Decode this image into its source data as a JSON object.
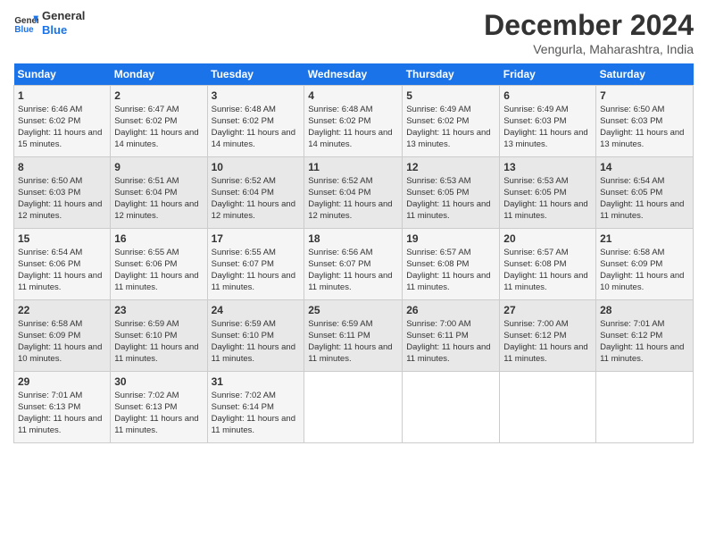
{
  "header": {
    "logo_line1": "General",
    "logo_line2": "Blue",
    "month": "December 2024",
    "location": "Vengurla, Maharashtra, India"
  },
  "days_of_week": [
    "Sunday",
    "Monday",
    "Tuesday",
    "Wednesday",
    "Thursday",
    "Friday",
    "Saturday"
  ],
  "weeks": [
    [
      {
        "day": "1",
        "info": "Sunrise: 6:46 AM\nSunset: 6:02 PM\nDaylight: 11 hours and 15 minutes."
      },
      {
        "day": "2",
        "info": "Sunrise: 6:47 AM\nSunset: 6:02 PM\nDaylight: 11 hours and 14 minutes."
      },
      {
        "day": "3",
        "info": "Sunrise: 6:48 AM\nSunset: 6:02 PM\nDaylight: 11 hours and 14 minutes."
      },
      {
        "day": "4",
        "info": "Sunrise: 6:48 AM\nSunset: 6:02 PM\nDaylight: 11 hours and 14 minutes."
      },
      {
        "day": "5",
        "info": "Sunrise: 6:49 AM\nSunset: 6:02 PM\nDaylight: 11 hours and 13 minutes."
      },
      {
        "day": "6",
        "info": "Sunrise: 6:49 AM\nSunset: 6:03 PM\nDaylight: 11 hours and 13 minutes."
      },
      {
        "day": "7",
        "info": "Sunrise: 6:50 AM\nSunset: 6:03 PM\nDaylight: 11 hours and 13 minutes."
      }
    ],
    [
      {
        "day": "8",
        "info": "Sunrise: 6:50 AM\nSunset: 6:03 PM\nDaylight: 11 hours and 12 minutes."
      },
      {
        "day": "9",
        "info": "Sunrise: 6:51 AM\nSunset: 6:04 PM\nDaylight: 11 hours and 12 minutes."
      },
      {
        "day": "10",
        "info": "Sunrise: 6:52 AM\nSunset: 6:04 PM\nDaylight: 11 hours and 12 minutes."
      },
      {
        "day": "11",
        "info": "Sunrise: 6:52 AM\nSunset: 6:04 PM\nDaylight: 11 hours and 12 minutes."
      },
      {
        "day": "12",
        "info": "Sunrise: 6:53 AM\nSunset: 6:05 PM\nDaylight: 11 hours and 11 minutes."
      },
      {
        "day": "13",
        "info": "Sunrise: 6:53 AM\nSunset: 6:05 PM\nDaylight: 11 hours and 11 minutes."
      },
      {
        "day": "14",
        "info": "Sunrise: 6:54 AM\nSunset: 6:05 PM\nDaylight: 11 hours and 11 minutes."
      }
    ],
    [
      {
        "day": "15",
        "info": "Sunrise: 6:54 AM\nSunset: 6:06 PM\nDaylight: 11 hours and 11 minutes."
      },
      {
        "day": "16",
        "info": "Sunrise: 6:55 AM\nSunset: 6:06 PM\nDaylight: 11 hours and 11 minutes."
      },
      {
        "day": "17",
        "info": "Sunrise: 6:55 AM\nSunset: 6:07 PM\nDaylight: 11 hours and 11 minutes."
      },
      {
        "day": "18",
        "info": "Sunrise: 6:56 AM\nSunset: 6:07 PM\nDaylight: 11 hours and 11 minutes."
      },
      {
        "day": "19",
        "info": "Sunrise: 6:57 AM\nSunset: 6:08 PM\nDaylight: 11 hours and 11 minutes."
      },
      {
        "day": "20",
        "info": "Sunrise: 6:57 AM\nSunset: 6:08 PM\nDaylight: 11 hours and 11 minutes."
      },
      {
        "day": "21",
        "info": "Sunrise: 6:58 AM\nSunset: 6:09 PM\nDaylight: 11 hours and 10 minutes."
      }
    ],
    [
      {
        "day": "22",
        "info": "Sunrise: 6:58 AM\nSunset: 6:09 PM\nDaylight: 11 hours and 10 minutes."
      },
      {
        "day": "23",
        "info": "Sunrise: 6:59 AM\nSunset: 6:10 PM\nDaylight: 11 hours and 11 minutes."
      },
      {
        "day": "24",
        "info": "Sunrise: 6:59 AM\nSunset: 6:10 PM\nDaylight: 11 hours and 11 minutes."
      },
      {
        "day": "25",
        "info": "Sunrise: 6:59 AM\nSunset: 6:11 PM\nDaylight: 11 hours and 11 minutes."
      },
      {
        "day": "26",
        "info": "Sunrise: 7:00 AM\nSunset: 6:11 PM\nDaylight: 11 hours and 11 minutes."
      },
      {
        "day": "27",
        "info": "Sunrise: 7:00 AM\nSunset: 6:12 PM\nDaylight: 11 hours and 11 minutes."
      },
      {
        "day": "28",
        "info": "Sunrise: 7:01 AM\nSunset: 6:12 PM\nDaylight: 11 hours and 11 minutes."
      }
    ],
    [
      {
        "day": "29",
        "info": "Sunrise: 7:01 AM\nSunset: 6:13 PM\nDaylight: 11 hours and 11 minutes."
      },
      {
        "day": "30",
        "info": "Sunrise: 7:02 AM\nSunset: 6:13 PM\nDaylight: 11 hours and 11 minutes."
      },
      {
        "day": "31",
        "info": "Sunrise: 7:02 AM\nSunset: 6:14 PM\nDaylight: 11 hours and 11 minutes."
      },
      null,
      null,
      null,
      null
    ]
  ]
}
